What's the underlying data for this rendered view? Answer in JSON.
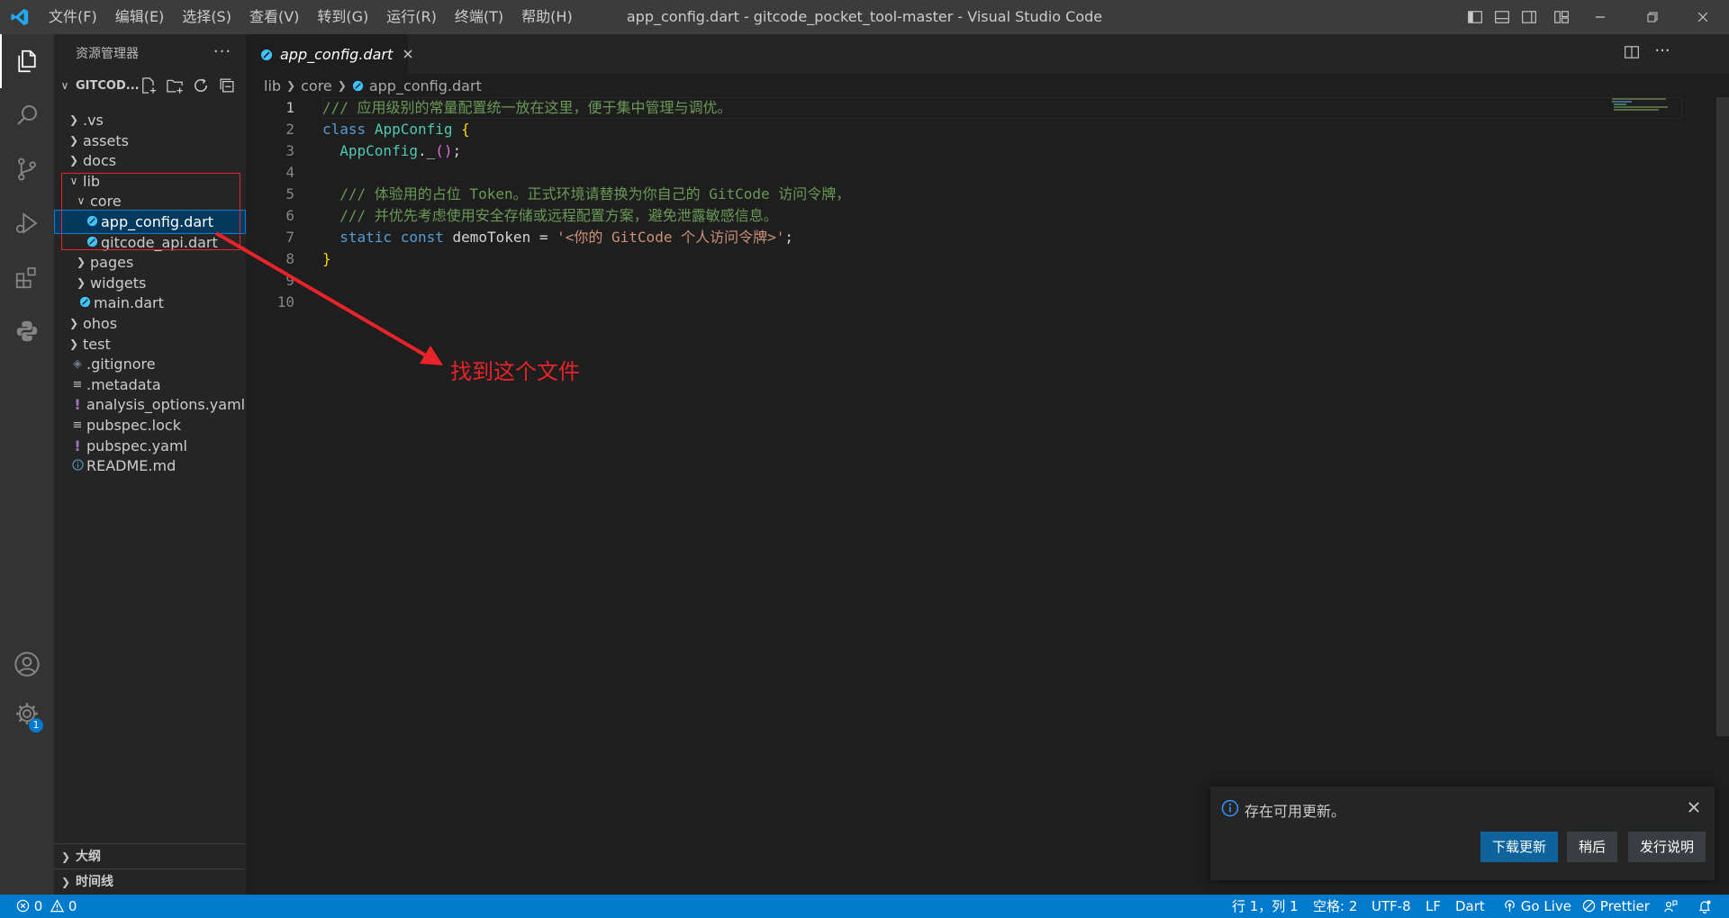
{
  "titlebar": {
    "menus": [
      "文件(F)",
      "编辑(E)",
      "选择(S)",
      "查看(V)",
      "转到(G)",
      "运行(R)",
      "终端(T)",
      "帮助(H)"
    ],
    "title": "app_config.dart - gitcode_pocket_tool-master - Visual Studio Code"
  },
  "sidebar": {
    "header": "资源管理器",
    "root": "GITCOD...",
    "tree": [
      {
        "label": ".vs",
        "depth": 0,
        "type": "folder",
        "expanded": false
      },
      {
        "label": "assets",
        "depth": 0,
        "type": "folder",
        "expanded": false
      },
      {
        "label": "docs",
        "depth": 0,
        "type": "folder",
        "expanded": false
      },
      {
        "label": "lib",
        "depth": 0,
        "type": "folder",
        "expanded": true
      },
      {
        "label": "core",
        "depth": 1,
        "type": "folder",
        "expanded": true
      },
      {
        "label": "app_config.dart",
        "depth": 2,
        "type": "dart",
        "selected": true
      },
      {
        "label": "gitcode_api.dart",
        "depth": 2,
        "type": "dart"
      },
      {
        "label": "pages",
        "depth": 1,
        "type": "folder",
        "expanded": false
      },
      {
        "label": "widgets",
        "depth": 1,
        "type": "folder",
        "expanded": false
      },
      {
        "label": "main.dart",
        "depth": 1,
        "type": "dart"
      },
      {
        "label": "ohos",
        "depth": 0,
        "type": "folder",
        "expanded": false
      },
      {
        "label": "test",
        "depth": 0,
        "type": "folder",
        "expanded": false
      },
      {
        "label": ".gitignore",
        "depth": 0,
        "type": "git"
      },
      {
        "label": ".metadata",
        "depth": 0,
        "type": "lines"
      },
      {
        "label": "analysis_options.yaml",
        "depth": 0,
        "type": "yaml"
      },
      {
        "label": "pubspec.lock",
        "depth": 0,
        "type": "lines"
      },
      {
        "label": "pubspec.yaml",
        "depth": 0,
        "type": "yaml"
      },
      {
        "label": "README.md",
        "depth": 0,
        "type": "info"
      }
    ],
    "outline": "大纲",
    "timeline": "时间线"
  },
  "editor": {
    "tab_label": "app_config.dart",
    "breadcrumb": [
      "lib",
      "core",
      "app_config.dart"
    ],
    "line_numbers": [
      "1",
      "2",
      "3",
      "4",
      "5",
      "6",
      "7",
      "8",
      "9",
      "10"
    ],
    "code": {
      "l1": "/// 应用级别的常量配置统一放在这里，便于集中管理与调优。",
      "l2_kw": "class",
      "l2_cls": "AppConfig",
      "l2_br": "{",
      "l3_cls": "AppConfig",
      "l3_rest": "._",
      "l3_br": "()",
      "l3_semi": ";",
      "l5": "/// 体验用的占位 Token。正式环境请替换为你自己的 GitCode 访问令牌，",
      "l6": "/// 并优先考虑使用安全存储或远程配置方案，避免泄露敏感信息。",
      "l7_kw": "static const",
      "l7_name": "demoToken",
      "l7_eq": "=",
      "l7_str": "'<你的 GitCode 个人访问令牌>'",
      "l7_semi": ";",
      "l8_br": "}"
    }
  },
  "annotation": {
    "text": "找到这个文件",
    "color": "#e8232a"
  },
  "notification": {
    "message": "存在可用更新。",
    "buttons": [
      "下载更新",
      "稍后",
      "发行说明"
    ]
  },
  "statusbar": {
    "errors": "0",
    "warnings": "0",
    "position": "行 1，列 1",
    "spaces": "空格: 2",
    "encoding": "UTF-8",
    "eol": "LF",
    "language": "Dart",
    "golive": "Go Live",
    "prettier": "Prettier"
  },
  "badges": {
    "settings_count": "1"
  },
  "colors": {
    "accent": "#007acc",
    "title_bar": "#3c3c3c",
    "activity_bar": "#333333",
    "sidebar": "#252526",
    "editor": "#1e1e1e"
  }
}
